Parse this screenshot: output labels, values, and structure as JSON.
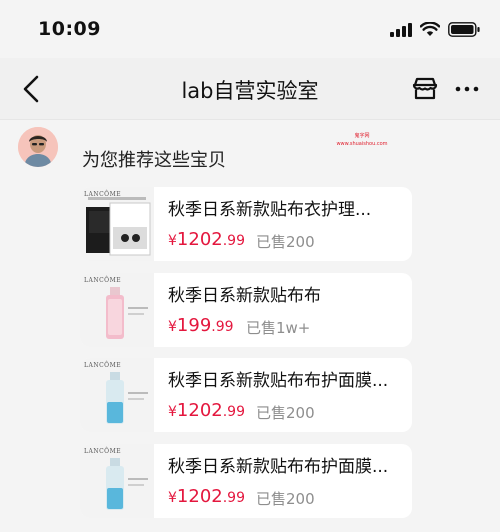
{
  "status_bar": {
    "time": "10:09"
  },
  "nav": {
    "title": "lab自营实验室"
  },
  "watermark": {
    "line1": "鬼字网",
    "line2": "www.shuaishou.com"
  },
  "chat": {
    "intro": "为您推荐这些宝贝"
  },
  "products": [
    {
      "title": "秋季日系新款贴布衣护理...",
      "price_symbol": "¥",
      "price_int": "1202",
      "price_dec": ".99",
      "sold": "已售200",
      "brand": "LANCÔME",
      "thumb": "mask-box"
    },
    {
      "title": "秋季日系新款贴布布",
      "price_symbol": "¥",
      "price_int": "199",
      "price_dec": ".99",
      "sold": "已售1w+",
      "brand": "LANCÔME",
      "thumb": "pink-bottle"
    },
    {
      "title": "秋季日系新款贴布布护面膜...",
      "price_symbol": "¥",
      "price_int": "1202",
      "price_dec": ".99",
      "sold": "已售200",
      "brand": "LANCÔME",
      "thumb": "blue-bottle"
    },
    {
      "title": "秋季日系新款贴布布护面膜...",
      "price_symbol": "¥",
      "price_int": "1202",
      "price_dec": ".99",
      "sold": "已售200",
      "brand": "LANCÔME",
      "thumb": "blue-bottle"
    }
  ],
  "colors": {
    "price": "#e4173e",
    "background": "#f4f4f4",
    "card": "#ffffff",
    "sold": "#8e8e8e"
  }
}
